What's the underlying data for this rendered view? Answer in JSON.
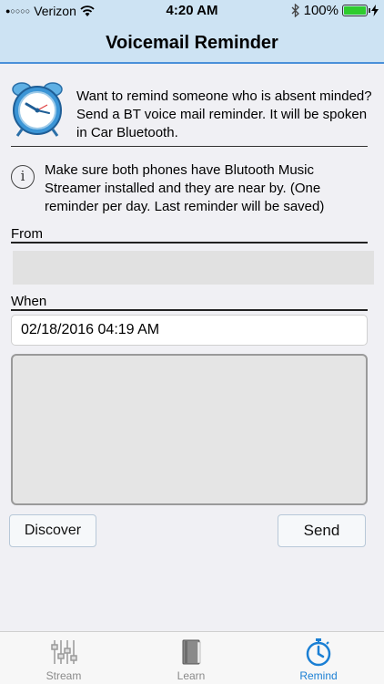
{
  "status_bar": {
    "signal": "●○○○○",
    "carrier": "Verizon",
    "time": "4:20 AM",
    "battery": "100%",
    "battery_level": 1.0
  },
  "nav": {
    "title": "Voicemail Reminder"
  },
  "intro": {
    "icon": "alarm-clock-icon",
    "text": "Want to remind someone who is absent minded? Send a BT voice mail reminder. It will be spoken in Car Bluetooth."
  },
  "info": {
    "icon": "info-icon",
    "glyph": "i",
    "text": "Make sure both phones have Blutooth Music Streamer installed and they are near by. (One reminder per day. Last reminder will be saved)"
  },
  "from": {
    "label": "From",
    "value": ""
  },
  "when": {
    "label": "When",
    "value": "02/18/2016 04:19 AM"
  },
  "message": {
    "value": ""
  },
  "buttons": {
    "discover": "Discover",
    "send": "Send"
  },
  "tabs": [
    {
      "label": "Stream",
      "icon": "equalizer-icon",
      "active": false
    },
    {
      "label": "Learn",
      "icon": "book-icon",
      "active": false
    },
    {
      "label": "Remind",
      "icon": "stopwatch-icon",
      "active": true
    }
  ],
  "colors": {
    "header_bg": "#cde3f3",
    "accent": "#1a7fd4",
    "battery": "#2ecc2e"
  }
}
